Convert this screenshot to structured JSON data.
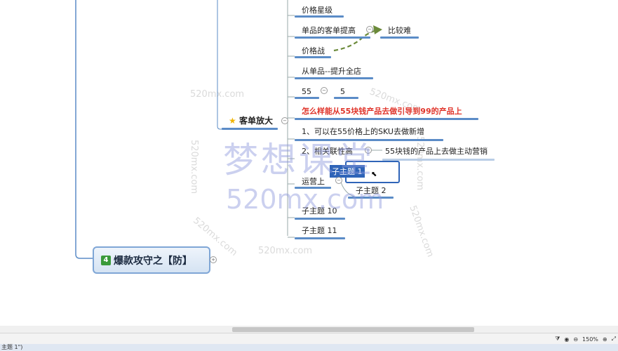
{
  "mindmap": {
    "central_topic": {
      "number": "4",
      "title": "爆款攻守之【防】"
    },
    "main_branch": {
      "label": "客单放大"
    },
    "topics": {
      "t1": "价格星级",
      "t2": "单品的客单提高",
      "t2_child": "比较难",
      "t3": "价格战",
      "t4": "从单品--提升全店",
      "t5": "55",
      "t5_child": "5",
      "t6": "怎么样能从55块钱产品去做引导到99的产品上",
      "t7": "1、可以在55价格上的SKU去做新增",
      "t8": "2、相关联性高",
      "t8_child": "55块钱的产品上去做主动营销",
      "t9": "运营上",
      "t9_child1": "子主题 1",
      "t9_child2": "子主题 2",
      "t10": "子主题 10",
      "t11": "子主题 11"
    },
    "colors": {
      "highlight_text": "#e0342a",
      "underline": "#5b8cc7",
      "selection": "#2f64b8",
      "arrow": "#6b8a3a"
    }
  },
  "watermarks": {
    "small": "520mx.com",
    "big_cn": "梦想课堂",
    "big_en": "520mx.com"
  },
  "statusbar": {
    "zoom": "150%"
  },
  "bottombar": {
    "text": "主题 1\")"
  }
}
